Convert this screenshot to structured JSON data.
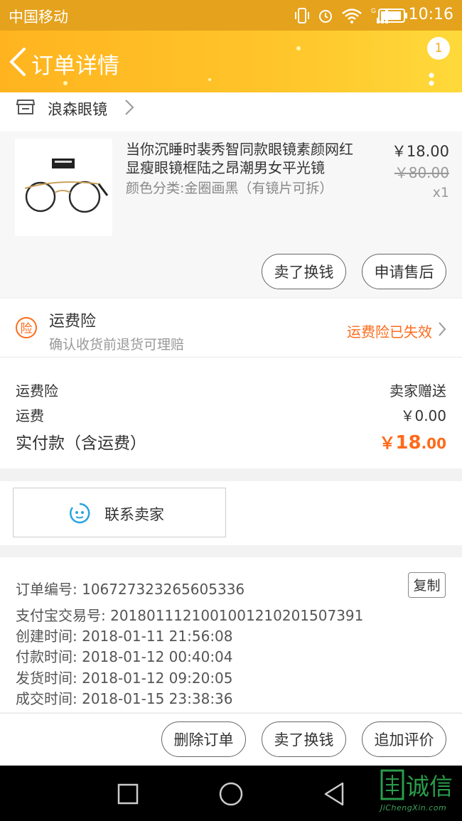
{
  "status_bar": {
    "carrier": "中国移动",
    "time": "10:16",
    "icons": [
      "vibrate-icon",
      "alarm-icon",
      "wifi-icon",
      "signal-icon",
      "battery-icon"
    ]
  },
  "nav": {
    "title": "订单详情",
    "badge_count": "1"
  },
  "shop": {
    "name": "浪森眼镜"
  },
  "product": {
    "title": "当你沉睡时裴秀智同款眼镜素颜网红显瘦眼镜框陆之昂潮男女平光镜",
    "spec": "颜色分类:金圈画黑（有镜片可拆）",
    "price": "￥18.00",
    "original_price": "￥80.00",
    "quantity": "x1",
    "actions": [
      "卖了换钱",
      "申请售后"
    ]
  },
  "insurance": {
    "icon_char": "险",
    "title": "运费险",
    "subtitle": "确认收货前退货可理赔",
    "status": "运费险已失效"
  },
  "fees": {
    "shipping_insurance_label": "运费险",
    "shipping_insurance_value": "卖家赠送",
    "shipping_label": "运费",
    "shipping_value": "￥0.00",
    "total_label": "实付款（含运费）",
    "total_currency": "￥",
    "total_integer": "18",
    "total_decimal": ".00"
  },
  "contact": {
    "label": "联系卖家"
  },
  "order_info": {
    "order_no": "订单编号: 1067273232656053​36",
    "alipay_no": "支付宝交易号: 2018011121001001210201507391",
    "created": "创建时间: 2018-01-11 21:56:08",
    "paid": "付款时间: 2018-01-12 00:40:04",
    "shipped": "发货时间: 2018-01-12 09:20:05",
    "completed": "成交时间: 2018-01-15 23:38:36",
    "copy_label": "复制"
  },
  "bottom_actions": [
    "删除订单",
    "卖了换钱",
    "追加评价"
  ],
  "watermark": {
    "text": "诚信",
    "sub": "JiChengXin.com"
  },
  "colors": {
    "accent": "#ffb41f",
    "price_orange": "#ff6a1a"
  }
}
